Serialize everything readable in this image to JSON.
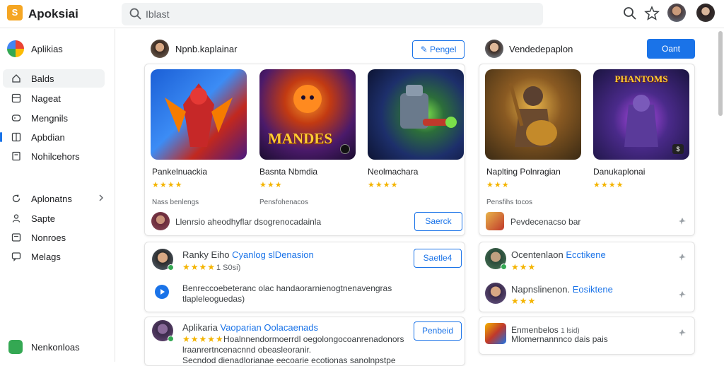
{
  "app": {
    "logo_letter": "S",
    "title": "Apoksiai"
  },
  "search": {
    "value": "Iblast"
  },
  "sidebar": {
    "header_label": "Aplikias",
    "items": [
      {
        "label": "Balds"
      },
      {
        "label": "Nageat"
      },
      {
        "label": "Mengnils"
      },
      {
        "label": "Apbdian"
      },
      {
        "label": "Nohilcehors"
      },
      {
        "label": "Aplonatns"
      },
      {
        "label": "Sapte"
      },
      {
        "label": "Nonroes"
      },
      {
        "label": "Melags"
      }
    ],
    "footer_label": "Nenkonloas"
  },
  "section1": {
    "title": "Npnb.kaplainar",
    "button_label": "Pengel",
    "games": [
      {
        "name": "Pankelnuackia",
        "stars": "★★★★",
        "tile_text": ""
      },
      {
        "name": "Basnta Nbmdia",
        "stars": "★★★",
        "tile_text": "MANDES"
      },
      {
        "name": "Neolmachara",
        "stars": "★★★★",
        "tile_text": ""
      }
    ],
    "meta": [
      "Nass benlengs",
      "Pensfohenacos"
    ],
    "footer_text": "Llenrsio aheodhyflar dsogrenocadainla",
    "footer_button": "Saerck"
  },
  "section2": {
    "title": "Vendedepaplon",
    "button_label": "Oant",
    "games": [
      {
        "name": "Naplting Polnragian",
        "stars": "★★★",
        "tile_text": ""
      },
      {
        "name": "Danukaplonai",
        "stars": "★★★★",
        "tile_text": "PHANTOMS"
      }
    ],
    "meta": [
      "Pensfihs tocos"
    ],
    "footer_text": "Pevdecenacso bar"
  },
  "list_left": [
    {
      "name": "Ranky Eiho",
      "tag": "Cyanlog slDenasion",
      "rating_text": "1 S0si)",
      "stars": "★★★★",
      "description_line1": "Benreccoebeteranc olac handaorarnienogtnenavengras",
      "description_line2": "tlapleleoguedas)",
      "button": "Saetle4"
    },
    {
      "name": "Aplikaria",
      "tag": "Vaoparian Oolacaenads",
      "stars": "★★★★★",
      "description_line1": "Hoalnnendormoerrdl oegolongocoanrenadonors",
      "description_line2": "lraanrertncenacnnd obeasleoranir.",
      "description_line3": "Secndod dienadlorianae eecoarie ecotionas sanolnpstpe",
      "button": "Penbeid"
    }
  ],
  "list_right": [
    {
      "name": "Ocentenlaon",
      "tag": "Ecctikene",
      "stars": "★★★"
    },
    {
      "name": "Napnslinenon.",
      "tag": "Eosiktene",
      "stars": "★★★"
    },
    {
      "name": "Enmenbelos",
      "tag": "1 lsid)",
      "line2": "Mlomernannnco dais pais"
    }
  ]
}
